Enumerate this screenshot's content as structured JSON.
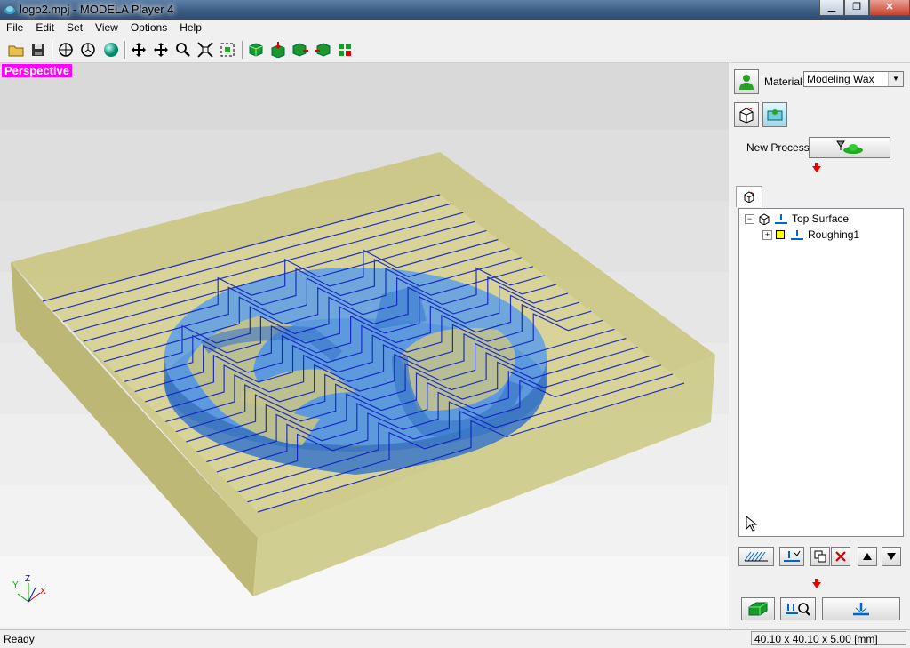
{
  "window": {
    "title": "logo2.mpj - MODELA Player 4",
    "minimize": "▁",
    "maximize": "❐",
    "close": "✕"
  },
  "menu": [
    "File",
    "Edit",
    "Set",
    "View",
    "Options",
    "Help"
  ],
  "viewport": {
    "label": "Perspective",
    "axes": {
      "x": "X",
      "y": "Y",
      "z": "Z"
    }
  },
  "panel": {
    "material_label": "Material",
    "material_value": "Modeling Wax",
    "new_process_label": "New Process",
    "tree": {
      "root": "Top Surface",
      "child": "Roughing1"
    }
  },
  "status": {
    "left": "Ready",
    "right": "40.10 x 40.10 x 5.00 [mm]"
  },
  "colors": {
    "accent": "#ff00ff",
    "wax": "#c8c47a",
    "model": "#4a8fe0",
    "toolpath": "#1020c0"
  }
}
